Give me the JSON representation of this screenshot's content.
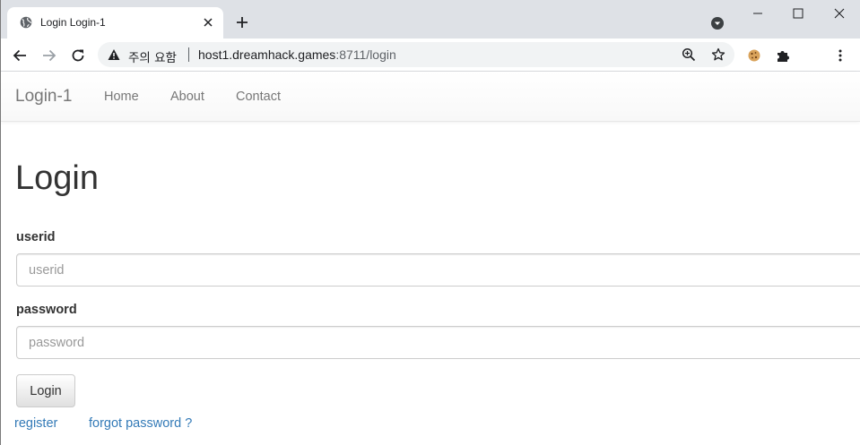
{
  "browser": {
    "tab_title": "Login Login-1",
    "security_label": "주의 요함",
    "url_host": "host1.dreamhack.games",
    "url_rest": ":8711/login"
  },
  "icons": {
    "tab_favicon": "globe-icon",
    "tab_close": "close-icon",
    "new_tab": "plus-icon",
    "tab_search": "chevron-down-circle-icon",
    "minimize": "minimize-icon",
    "maximize": "maximize-icon",
    "close_window": "close-icon",
    "back": "arrow-left-icon",
    "forward": "arrow-right-icon",
    "reload": "reload-icon",
    "warning": "warning-triangle-icon",
    "zoom": "zoom-icon",
    "bookmark": "star-icon",
    "extension_cookie": "cookie-icon",
    "extensions": "puzzle-icon",
    "menu": "more-vertical-icon"
  },
  "navbar": {
    "brand": "Login-1",
    "links": [
      "Home",
      "About",
      "Contact"
    ]
  },
  "form": {
    "title": "Login",
    "userid_label": "userid",
    "userid_placeholder": "userid",
    "password_label": "password",
    "password_placeholder": "password",
    "submit_label": "Login"
  },
  "links": {
    "register": "register",
    "forgot": "forgot password ?"
  },
  "colors": {
    "link": "#337ab7",
    "tabstrip": "#dee1e6",
    "navbar_text": "#777777"
  }
}
